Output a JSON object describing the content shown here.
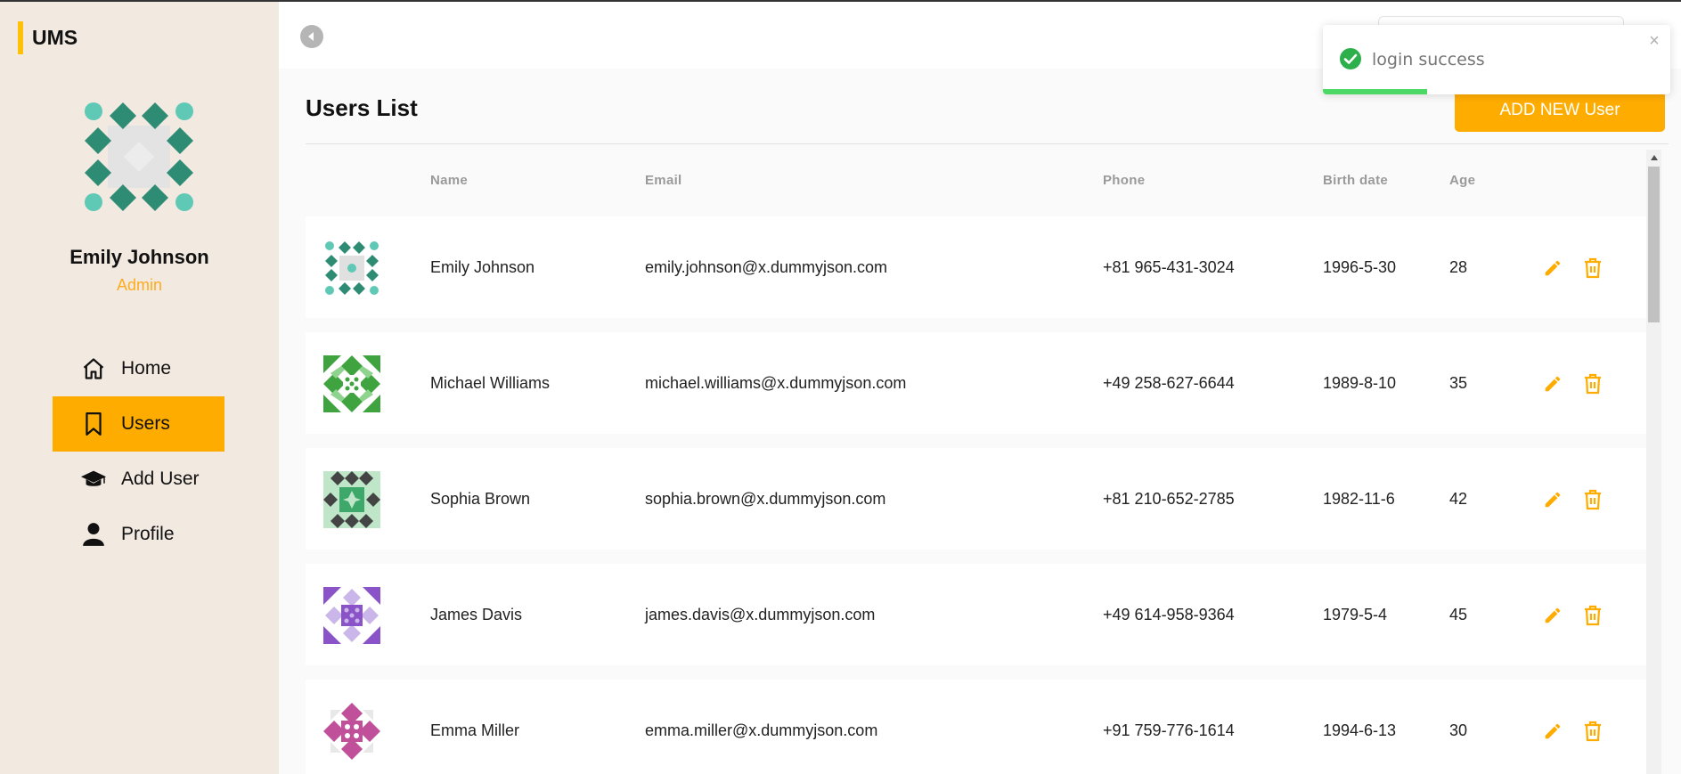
{
  "app": {
    "title": "UMS"
  },
  "profile": {
    "name": "Emily Johnson",
    "role": "Admin"
  },
  "nav": [
    {
      "label": "Home",
      "icon": "home-icon",
      "active": false
    },
    {
      "label": "Users",
      "icon": "bookmark-icon",
      "active": true
    },
    {
      "label": "Add User",
      "icon": "graduation-cap-icon",
      "active": false
    },
    {
      "label": "Profile",
      "icon": "person-icon",
      "active": false
    }
  ],
  "page": {
    "title": "Users List",
    "add_button": "ADD NEW User"
  },
  "table": {
    "headers": {
      "name": "Name",
      "email": "Email",
      "phone": "Phone",
      "birth": "Birth date",
      "age": "Age"
    },
    "rows": [
      {
        "name": "Emily Johnson",
        "email": "emily.johnson@x.dummyjson.com",
        "phone": "+81 965-431-3024",
        "birth": "1996-5-30",
        "age": "28",
        "avatar_color": "#2e8b74"
      },
      {
        "name": "Michael Williams",
        "email": "michael.williams@x.dummyjson.com",
        "phone": "+49 258-627-6644",
        "birth": "1989-8-10",
        "age": "35",
        "avatar_color": "#3fa43f"
      },
      {
        "name": "Sophia Brown",
        "email": "sophia.brown@x.dummyjson.com",
        "phone": "+81 210-652-2785",
        "birth": "1982-11-6",
        "age": "42",
        "avatar_color": "#444444"
      },
      {
        "name": "James Davis",
        "email": "james.davis@x.dummyjson.com",
        "phone": "+49 614-958-9364",
        "birth": "1979-5-4",
        "age": "45",
        "avatar_color": "#8a54c8"
      },
      {
        "name": "Emma Miller",
        "email": "emma.miller@x.dummyjson.com",
        "phone": "+91 759-776-1614",
        "birth": "1994-6-13",
        "age": "30",
        "avatar_color": "#c0509a"
      }
    ]
  },
  "toast": {
    "message": "login success",
    "progress": 0.3
  },
  "colors": {
    "accent": "#ffac00",
    "sidebar_bg": "#f2e9e1",
    "success": "#2db04b"
  }
}
